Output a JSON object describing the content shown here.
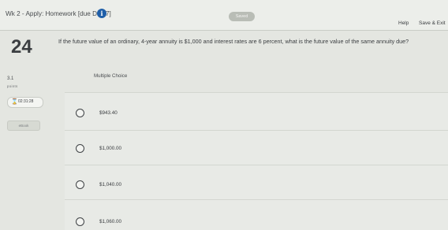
{
  "header": {
    "title": "Wk 2 - Apply: Homework [due Day 7]",
    "info_icon": "info-icon",
    "saved_label": "Saved",
    "help_label": "Help",
    "save_exit_label": "Save & Exit"
  },
  "question": {
    "number": "24",
    "text": "If the future value of an ordinary, 4-year annuity is $1,000 and interest rates are 6 percent, what is the future value of the same annuity due?",
    "points_value": "3.1",
    "points_label": "points",
    "type_label": "Multiple Choice"
  },
  "sidebar": {
    "timer": "02:31:28",
    "timer_icon": "hourglass-icon",
    "ebook_label": "eBook"
  },
  "options": [
    {
      "label": "$943.40"
    },
    {
      "label": "$1,000.00"
    },
    {
      "label": "$1,040.00"
    },
    {
      "label": "$1,060.00"
    }
  ],
  "colors": {
    "info_icon_bg": "#1f5fa8",
    "page_bg": "#e4e6e1"
  }
}
